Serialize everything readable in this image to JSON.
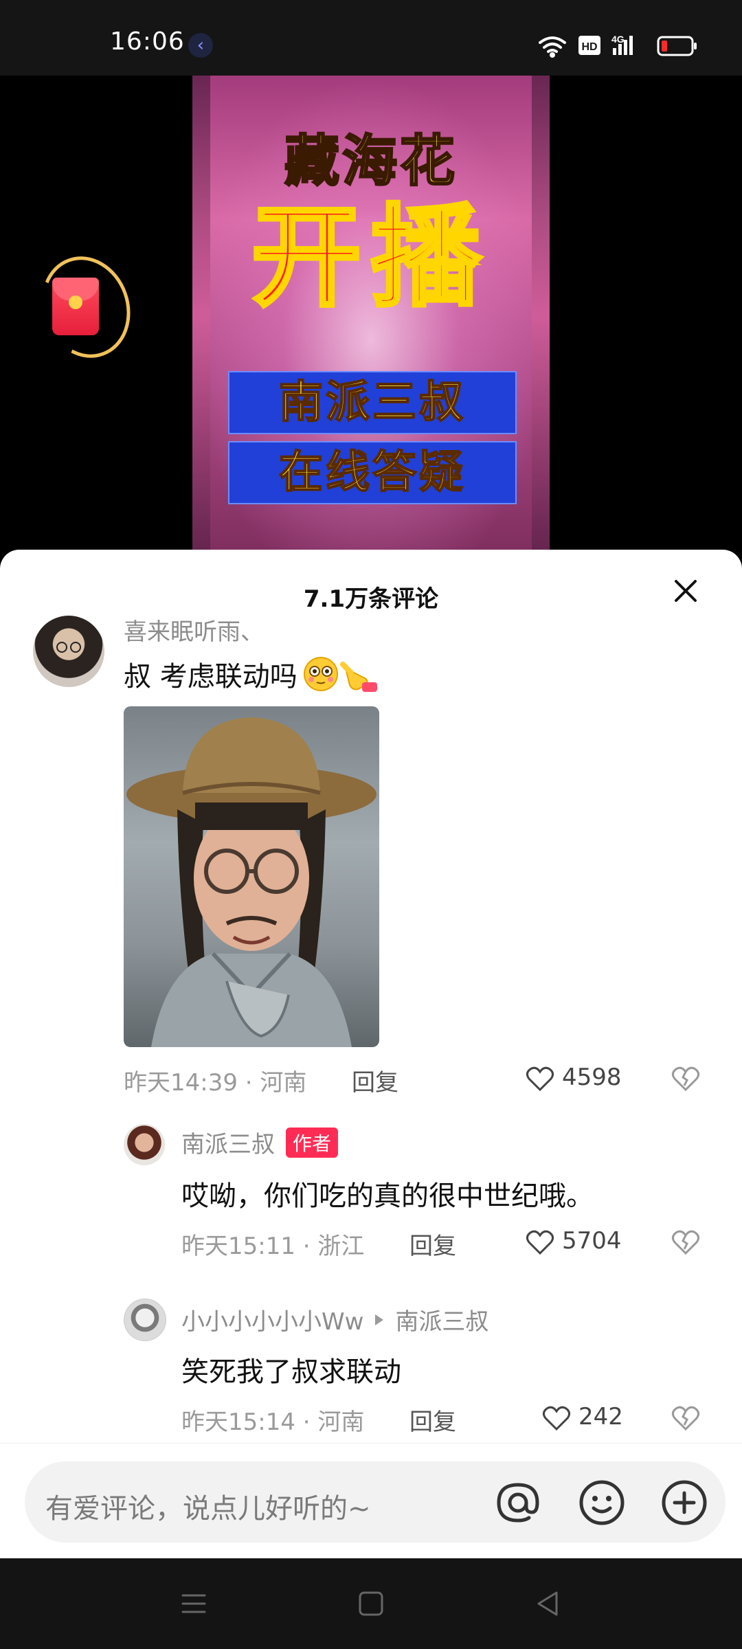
{
  "status_bar": {
    "time": "16:06",
    "hd_label": "HD",
    "network": "4G"
  },
  "video": {
    "title_top": "藏海花",
    "title_main": "开播",
    "box1": "南派三叔",
    "box2": "在线答疑"
  },
  "comments_panel": {
    "title": "7.1万条评论",
    "comments": [
      {
        "username": "喜来眠听雨、",
        "text": "叔 考虑联动吗",
        "time_location": "昨天14:39 · 河南",
        "reply_label": "回复",
        "likes": "4598"
      },
      {
        "username": "南派三叔",
        "badge": "作者",
        "text": "哎呦，你们吃的真的很中世纪哦。",
        "time_location": "昨天15:11 · 浙江",
        "reply_label": "回复",
        "likes": "5704"
      },
      {
        "username": "小小小小小小Ww",
        "reply_to": "南派三叔",
        "text": "笑死我了叔求联动",
        "time_location": "昨天15:14 · 河南",
        "reply_label": "回复",
        "likes": "242"
      }
    ]
  },
  "input": {
    "placeholder": "有爱评论，说点儿好听的~"
  },
  "colors": {
    "accent": "#fe2c55",
    "sheet_bg": "#ffffff",
    "status_bg": "#151515"
  }
}
